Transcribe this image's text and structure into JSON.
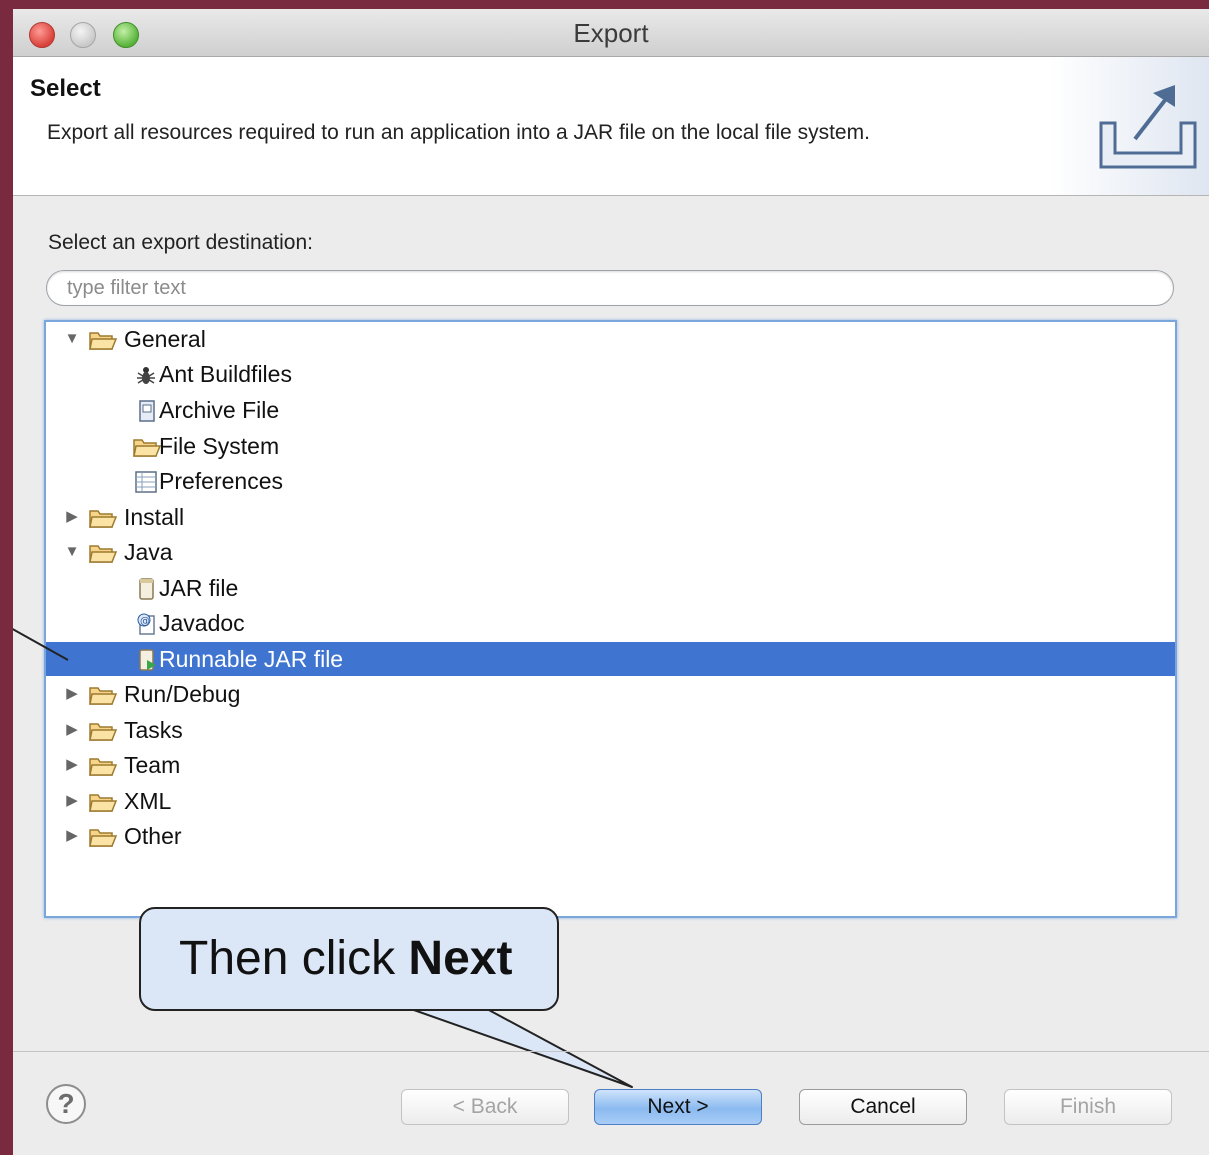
{
  "window": {
    "title": "Export"
  },
  "header": {
    "title": "Select",
    "description": "Export all resources required to run an application into a JAR file on the local file system."
  },
  "destination_label": "Select an export destination:",
  "filter": {
    "placeholder": "type filter text",
    "value": ""
  },
  "tree": [
    {
      "label": "General",
      "expanded": true,
      "icon": "folder-icon"
    },
    {
      "label": "Ant Buildfiles",
      "icon": "ant-icon"
    },
    {
      "label": "Archive File",
      "icon": "archive-icon"
    },
    {
      "label": "File System",
      "icon": "folder-icon"
    },
    {
      "label": "Preferences",
      "icon": "preferences-icon"
    },
    {
      "label": "Install",
      "expanded": false,
      "icon": "folder-icon"
    },
    {
      "label": "Java",
      "expanded": true,
      "icon": "folder-icon"
    },
    {
      "label": "JAR file",
      "icon": "jar-icon"
    },
    {
      "label": "Javadoc",
      "icon": "javadoc-icon"
    },
    {
      "label": "Runnable JAR file",
      "icon": "runnable-jar-icon",
      "selected": true
    },
    {
      "label": "Run/Debug",
      "expanded": false,
      "icon": "folder-icon"
    },
    {
      "label": "Tasks",
      "expanded": false,
      "icon": "folder-icon"
    },
    {
      "label": "Team",
      "expanded": false,
      "icon": "folder-icon"
    },
    {
      "label": "XML",
      "expanded": false,
      "icon": "folder-icon"
    },
    {
      "label": "Other",
      "expanded": false,
      "icon": "folder-icon"
    }
  ],
  "callout": {
    "text_prefix": "Then click ",
    "text_bold": "Next"
  },
  "buttons": {
    "help": "?",
    "back": "< Back",
    "next": "Next >",
    "cancel": "Cancel",
    "finish": "Finish"
  },
  "colors": {
    "selection": "#3f75d1",
    "callout_bg": "#dbe7f7",
    "page_border": "#7a2a3e"
  }
}
